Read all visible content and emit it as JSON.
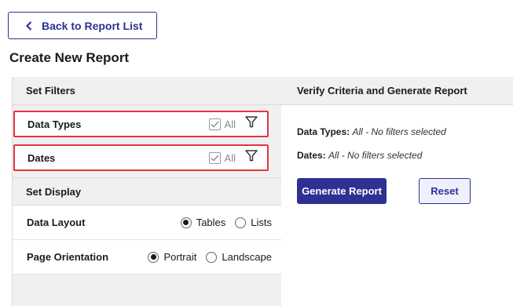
{
  "back_button": {
    "label": "Back to Report List"
  },
  "page_title": "Create New Report",
  "filters": {
    "heading": "Set Filters",
    "rows": [
      {
        "label": "Data Types",
        "all_label": "All"
      },
      {
        "label": "Dates",
        "all_label": "All"
      }
    ]
  },
  "display": {
    "heading": "Set Display",
    "data_layout": {
      "label": "Data Layout",
      "options": [
        "Tables",
        "Lists"
      ],
      "selected": "Tables"
    },
    "page_orientation": {
      "label": "Page Orientation",
      "options": [
        "Portrait",
        "Landscape"
      ],
      "selected": "Portrait"
    }
  },
  "verify": {
    "heading": "Verify Criteria and Generate Report",
    "data_types_label": "Data Types:",
    "data_types_value": "All - No filters selected",
    "dates_label": "Dates:",
    "dates_value": "All - No filters selected",
    "generate_label": "Generate Report",
    "reset_label": "Reset"
  },
  "colors": {
    "accent": "#2e3192",
    "highlight_border": "#e3343f",
    "panel_bg": "#f0f0f0"
  },
  "icons": [
    "chevron-left-icon",
    "checkbox-checked-icon",
    "filter-funnel-icon",
    "radio-selected-icon",
    "radio-unselected-icon"
  ]
}
